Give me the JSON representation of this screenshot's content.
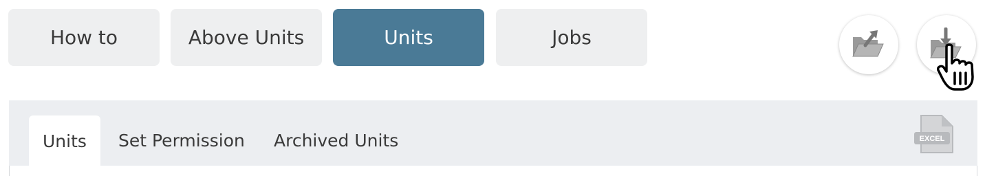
{
  "top_tabs": [
    {
      "label": "How to",
      "active": false
    },
    {
      "label": "Above Units",
      "active": false
    },
    {
      "label": "Units",
      "active": true
    },
    {
      "label": "Jobs",
      "active": false
    }
  ],
  "actions": {
    "upload_icon": "folder-upload-icon",
    "download_icon": "folder-download-icon",
    "cursor_icon": "hand-pointer-icon"
  },
  "sub_tabs": [
    {
      "label": "Units",
      "active": true
    },
    {
      "label": "Set Permission",
      "active": false
    },
    {
      "label": "Archived Units",
      "active": false
    }
  ],
  "export": {
    "icon": "excel-export-icon",
    "label": "EXCEL"
  },
  "colors": {
    "active_tab": "#4a7a96",
    "inactive_tab": "#eeeff0",
    "panel_bg": "#eceef1"
  }
}
